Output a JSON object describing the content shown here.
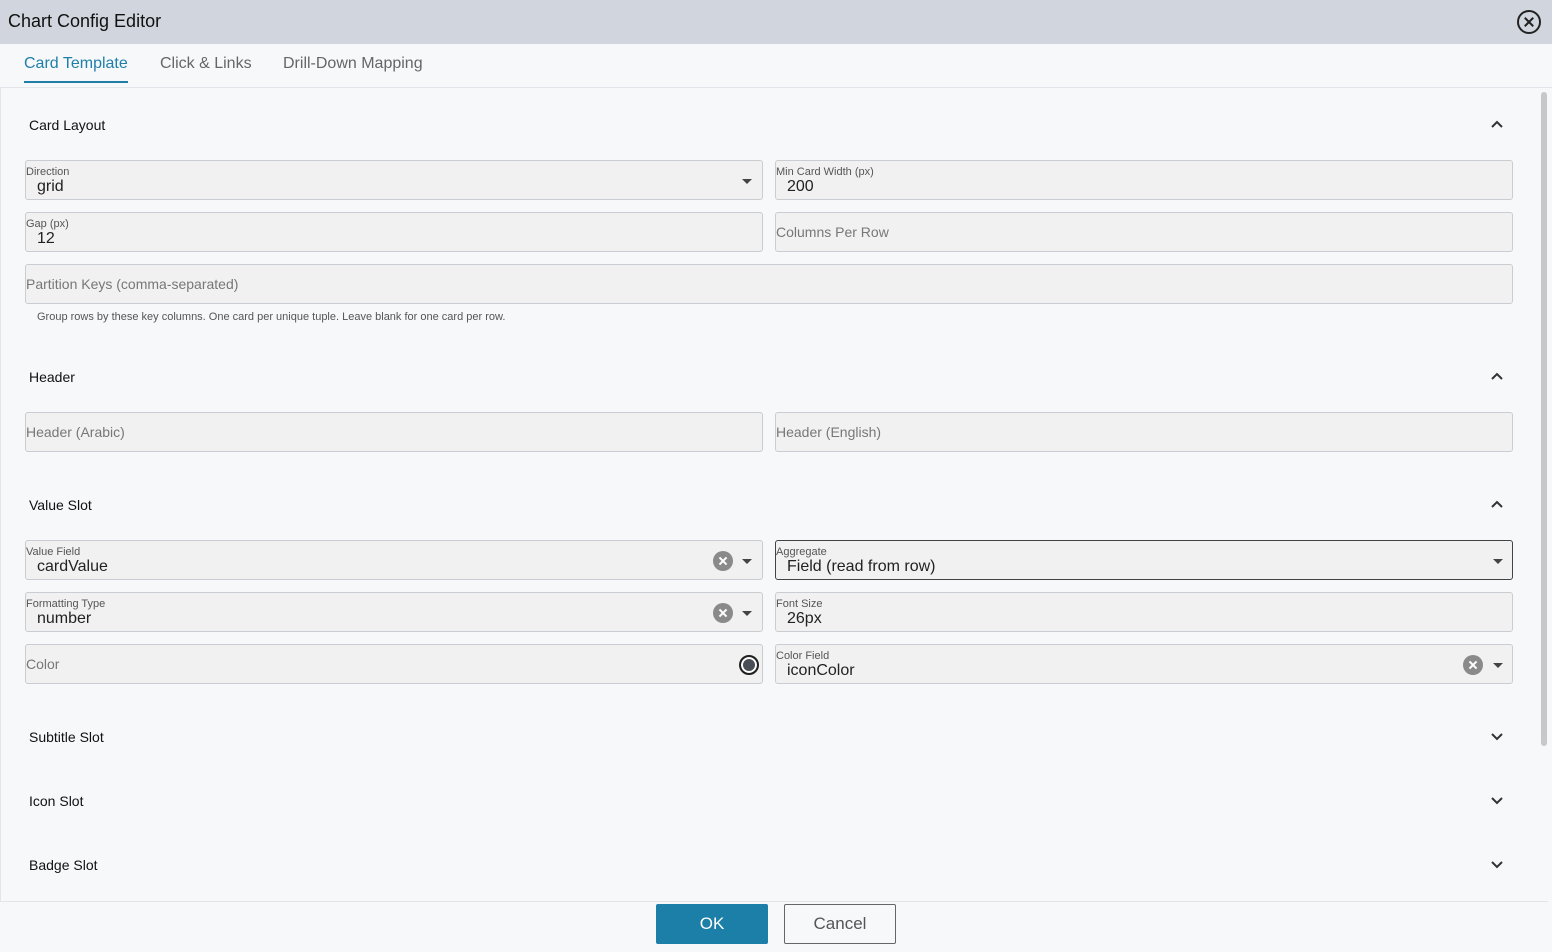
{
  "window": {
    "title": "Chart Config Editor",
    "close_icon": "close-circle-icon"
  },
  "tabs": [
    {
      "label": "Card Template",
      "active": true
    },
    {
      "label": "Click & Links",
      "active": false
    },
    {
      "label": "Drill-Down Mapping",
      "active": false
    }
  ],
  "sections": {
    "card_layout": {
      "title": "Card Layout",
      "expanded": true,
      "direction": {
        "label": "Direction",
        "value": "grid"
      },
      "min_card_width": {
        "label": "Min Card Width (px)",
        "value": "200"
      },
      "gap": {
        "label": "Gap (px)",
        "value": "12"
      },
      "columns_per_row": {
        "placeholder": "Columns Per Row"
      },
      "partition_keys": {
        "placeholder": "Partition Keys (comma-separated)"
      },
      "helper": "Group rows by these key columns. One card per unique tuple. Leave blank for one card per row."
    },
    "header": {
      "title": "Header",
      "expanded": true,
      "header_arabic": {
        "placeholder": "Header (Arabic)"
      },
      "header_english": {
        "placeholder": "Header (English)"
      }
    },
    "value_slot": {
      "title": "Value Slot",
      "expanded": true,
      "value_field": {
        "label": "Value Field",
        "value": "cardValue"
      },
      "aggregate": {
        "label": "Aggregate",
        "value": "Field (read from row)"
      },
      "formatting_type": {
        "label": "Formatting Type",
        "value": "number"
      },
      "font_size": {
        "label": "Font Size",
        "value": "26px"
      },
      "color": {
        "placeholder": "Color",
        "swatch_color": "#4a4f57"
      },
      "color_field": {
        "label": "Color Field",
        "value": "iconColor"
      }
    },
    "subtitle_slot": {
      "title": "Subtitle Slot",
      "expanded": false
    },
    "icon_slot": {
      "title": "Icon Slot",
      "expanded": false
    },
    "badge_slot": {
      "title": "Badge Slot",
      "expanded": false
    }
  },
  "footer": {
    "ok_label": "OK",
    "cancel_label": "Cancel"
  },
  "colors": {
    "accent": "#1f7fa8",
    "ok_button": "#1b7fa8",
    "titlebar": "#d1d6de"
  }
}
